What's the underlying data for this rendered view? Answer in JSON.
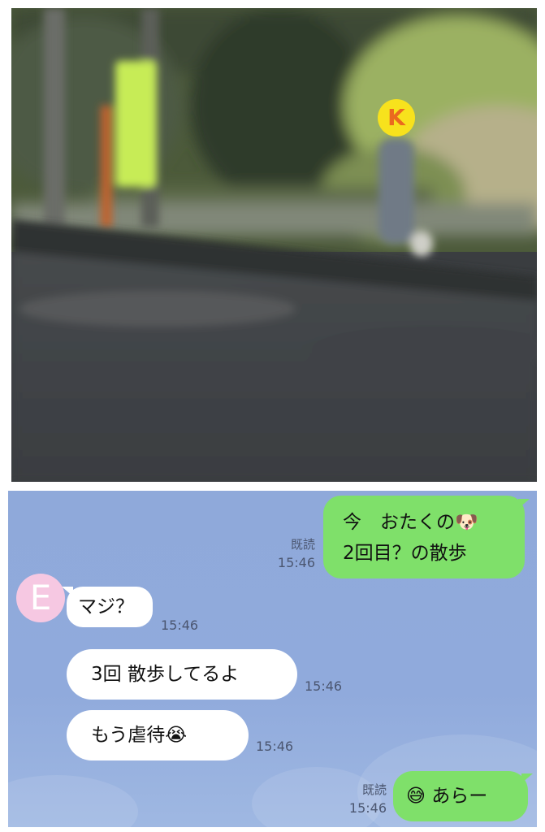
{
  "photo": {
    "badge_letter": "K"
  },
  "chat": {
    "avatar_letter": "E",
    "messages": [
      {
        "side": "out",
        "line1": "今　おたくの🐶",
        "line2": "2回目？の散歩",
        "read": "既読",
        "time": "15:46"
      },
      {
        "side": "in",
        "text": "マジ？",
        "time": "15:46"
      },
      {
        "side": "in",
        "text": "3回 散歩してるよ",
        "time": "15:46"
      },
      {
        "side": "in",
        "text": "もう虐待😭",
        "time": "15:46"
      },
      {
        "side": "out",
        "text": "😅 あらー",
        "read": "既読",
        "time": "15:46"
      }
    ]
  }
}
